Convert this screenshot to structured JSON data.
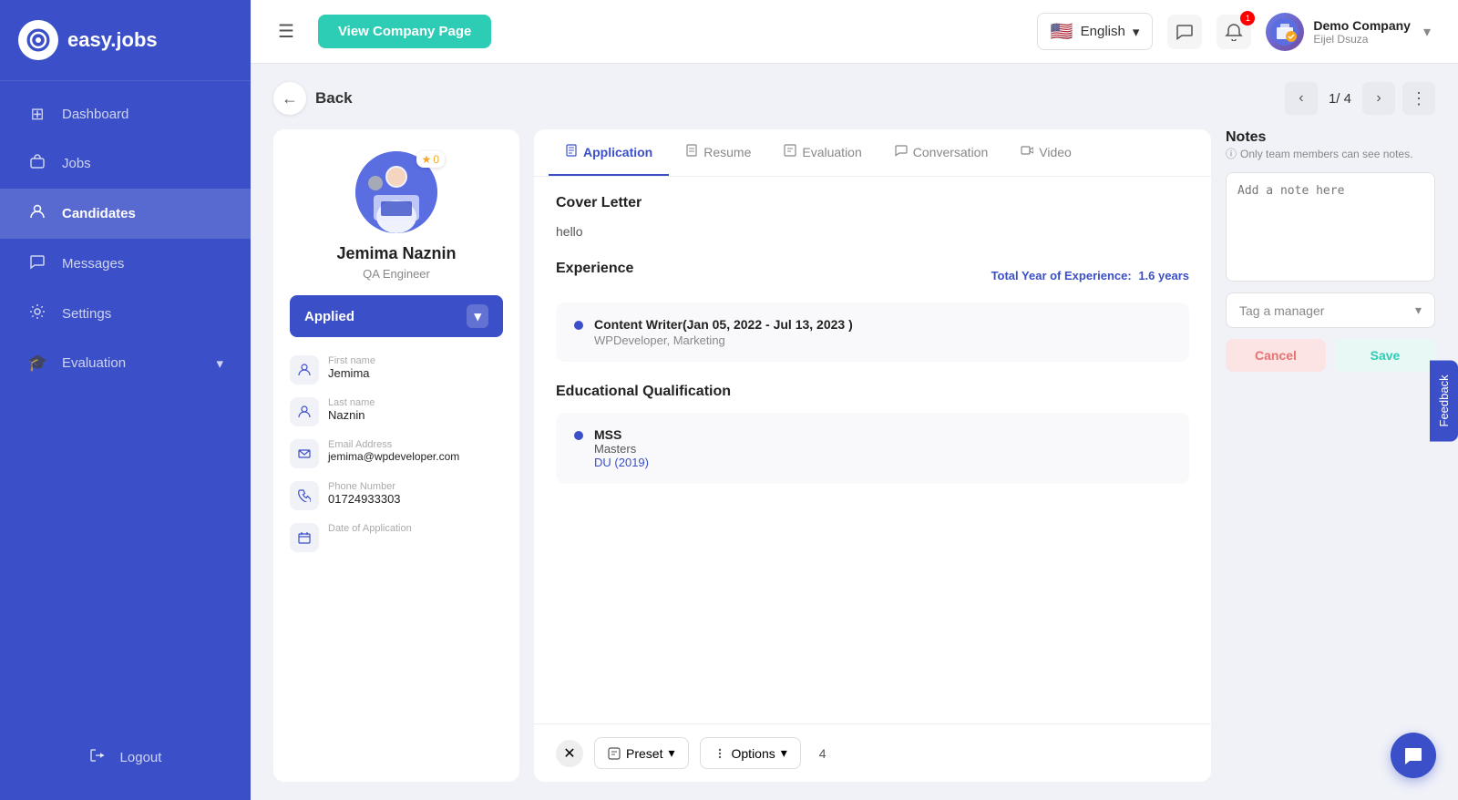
{
  "sidebar": {
    "logo_text": "easy.jobs",
    "logo_letter": "ej",
    "items": [
      {
        "label": "Dashboard",
        "icon": "⊞",
        "id": "dashboard"
      },
      {
        "label": "Jobs",
        "icon": "💼",
        "id": "jobs"
      },
      {
        "label": "Candidates",
        "icon": "👤",
        "id": "candidates",
        "active": true
      },
      {
        "label": "Messages",
        "icon": "💬",
        "id": "messages"
      },
      {
        "label": "Settings",
        "icon": "⚙",
        "id": "settings"
      },
      {
        "label": "Evaluation",
        "icon": "🎓",
        "id": "evaluation",
        "has_arrow": true
      }
    ],
    "logout_label": "Logout"
  },
  "topbar": {
    "view_company_label": "View Company Page",
    "language_label": "English",
    "company_name": "Demo Company",
    "company_sub": "Eijel Dsuza",
    "notification_count": "1"
  },
  "nav": {
    "back_label": "Back",
    "current_page": "1",
    "total_pages": "4",
    "page_display": "1/ 4"
  },
  "candidate": {
    "name": "Jemima Naznin",
    "role": "QA Engineer",
    "status": "Applied",
    "star_count": "0",
    "first_name_label": "First name",
    "first_name": "Jemima",
    "last_name_label": "Last name",
    "last_name": "Naznin",
    "email_label": "Email Address",
    "email": "jemima@wpdeveloper.com",
    "phone_label": "Phone Number",
    "phone": "01724933303",
    "date_label": "Date of Application"
  },
  "tabs": [
    {
      "id": "application",
      "label": "Application",
      "icon": "📄",
      "active": true
    },
    {
      "id": "resume",
      "label": "Resume",
      "icon": "📋"
    },
    {
      "id": "evaluation",
      "label": "Evaluation",
      "icon": "📝"
    },
    {
      "id": "conversation",
      "label": "Conversation",
      "icon": "💬"
    },
    {
      "id": "video",
      "label": "Video",
      "icon": "🎬"
    }
  ],
  "application": {
    "cover_letter_title": "Cover Letter",
    "cover_letter_text": "hello",
    "experience_title": "Experience",
    "experience_total_label": "Total Year of Experience:",
    "experience_duration": "1.6 years",
    "experience_items": [
      {
        "title": "Content Writer(Jan 05, 2022 - Jul 13, 2023 )",
        "sub": "WPDeveloper, Marketing"
      }
    ],
    "education_title": "Educational Qualification",
    "education_items": [
      {
        "degree": "MSS",
        "type": "Masters",
        "institution": "DU",
        "year": "(2019)"
      }
    ]
  },
  "notes": {
    "title": "Notes",
    "subtitle": "Only team members can see notes.",
    "placeholder": "Add a note here",
    "tag_placeholder": "Tag a manager",
    "cancel_label": "Cancel",
    "save_label": "Save"
  },
  "bottombar": {
    "preset_label": "Preset",
    "options_label": "Options",
    "count": "4"
  },
  "feedback": {
    "label": "Feedback"
  },
  "chat_icon": "💬"
}
